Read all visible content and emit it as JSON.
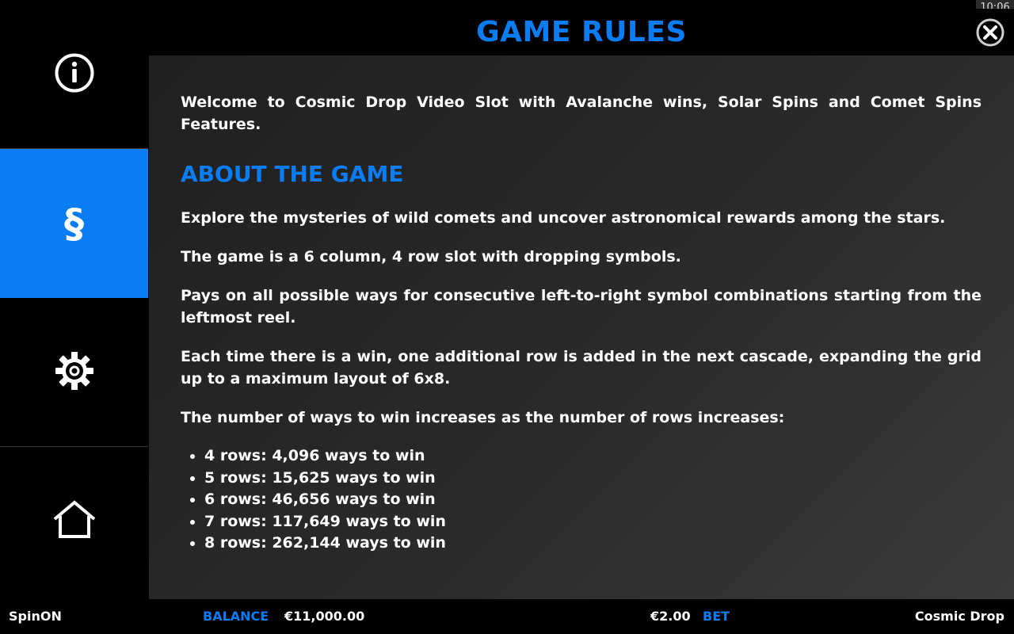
{
  "sidebar": {
    "items": [
      {
        "icon": "info-icon",
        "active": false
      },
      {
        "icon": "section-sign-icon",
        "glyph": "§",
        "active": true
      },
      {
        "icon": "gear-icon",
        "active": false
      },
      {
        "icon": "home-icon",
        "active": false
      }
    ]
  },
  "clock": "10:06",
  "header": {
    "title": "GAME RULES",
    "close_icon": "close-icon"
  },
  "content": {
    "intro": "Welcome to Cosmic Drop Video Slot with Avalanche wins, Solar Spins and Comet Spins Features.",
    "about_heading": "ABOUT THE GAME",
    "paragraphs": [
      "Explore the mysteries of wild comets and uncover astronomical rewards among the stars.",
      "The game is a 6 column, 4 row slot with dropping symbols.",
      "Pays on all possible ways for consecutive left-to-right symbol combinations starting from the leftmost reel.",
      "Each time there is a win, one additional row is added in the next cascade, expanding the grid up to a maximum layout of 6x8.",
      "The number of ways to win increases as the number of rows increases:"
    ],
    "ways_list": [
      "4 rows: 4,096 ways to win",
      "5 rows: 15,625 ways to win",
      "6 rows: 46,656 ways to win",
      "7 rows: 117,649 ways to win",
      "8 rows: 262,144 ways to win"
    ]
  },
  "bottom_bar": {
    "brand": "SpinON",
    "balance_label": "BALANCE",
    "balance_value": "€11,000.00",
    "bet_value": "€2.00",
    "bet_label": "BET",
    "game_name": "Cosmic Drop"
  },
  "colors": {
    "accent": "#0a7cf4",
    "background": "#000000",
    "panel": "#2a2a2a"
  }
}
